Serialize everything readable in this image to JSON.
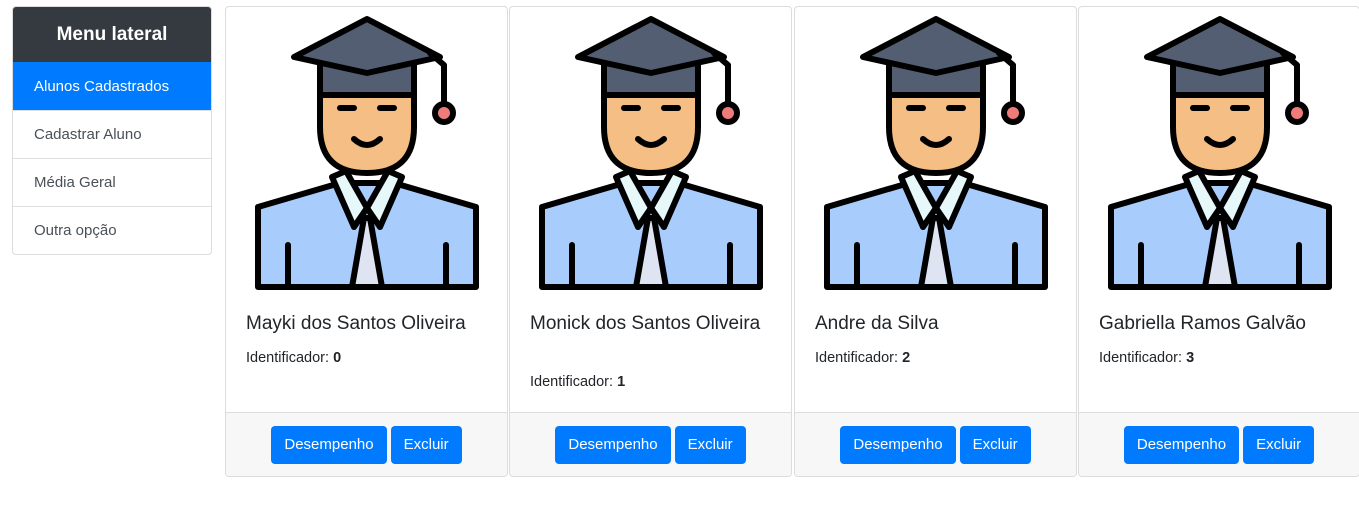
{
  "sidebar": {
    "title": "Menu lateral",
    "items": [
      {
        "label": "Alunos Cadastrados",
        "active": true
      },
      {
        "label": "Cadastrar Aluno",
        "active": false
      },
      {
        "label": "Média Geral",
        "active": false
      },
      {
        "label": "Outra opção",
        "active": false
      }
    ]
  },
  "cards": [
    {
      "name": "Mayki dos Santos Oliveira",
      "id_label": "Identificador:",
      "id_value": "0",
      "btn_performance": "Desempenho",
      "btn_delete": "Excluir"
    },
    {
      "name": "Monick dos Santos Oliveira",
      "id_label": "Identificador:",
      "id_value": "1",
      "btn_performance": "Desempenho",
      "btn_delete": "Excluir"
    },
    {
      "name": "Andre da Silva",
      "id_label": "Identificador:",
      "id_value": "2",
      "btn_performance": "Desempenho",
      "btn_delete": "Excluir"
    },
    {
      "name": "Gabriella Ramos Galvão",
      "id_label": "Identificador:",
      "id_value": "3",
      "btn_performance": "Desempenho",
      "btn_delete": "Excluir"
    }
  ],
  "colors": {
    "primary": "#007bff",
    "sidebar_header": "#343a40",
    "cap": "#545e72",
    "skin": "#f5be84",
    "shirt": "#a8cdfc",
    "collar": "#e6f8fa",
    "tassel": "#f07b7b"
  },
  "icons": {
    "card_image": "student-graduate-icon"
  }
}
